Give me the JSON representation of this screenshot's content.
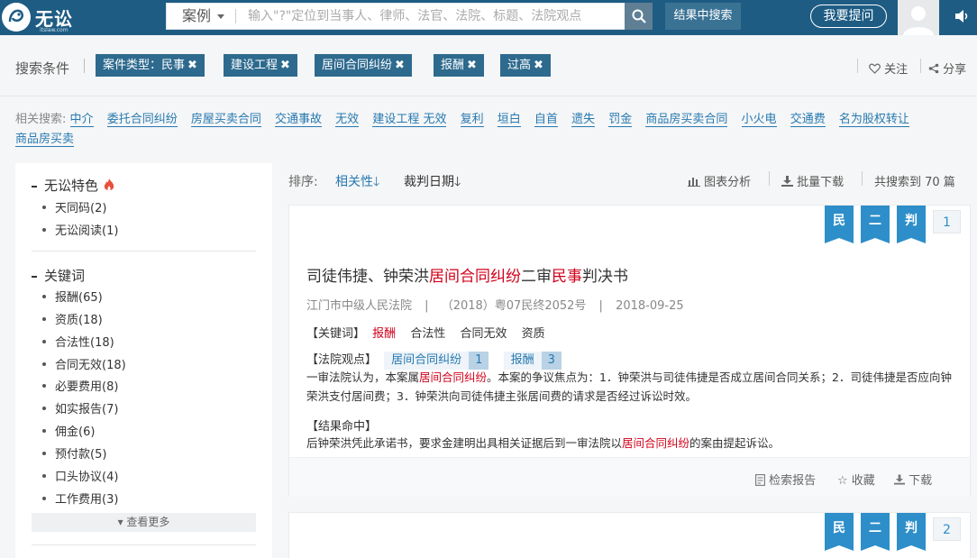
{
  "header": {
    "logo_text": "无讼",
    "logo_sub": "itslaw.com",
    "search_type": "案例",
    "search_placeholder": "输入\"?\"定位到当事人、律师、法官、法院、标题、法院观点",
    "within_label": "结果中搜索",
    "ask_label": "我要提问"
  },
  "filters": {
    "label": "搜索条件",
    "chips": [
      "案件类型：民事",
      "建设工程",
      "居间合同纠纷",
      "报酬",
      "过高"
    ],
    "follow": "关注",
    "share": "分享"
  },
  "related": {
    "label": "相关搜索:",
    "items": [
      "中介",
      "委托合同纠纷",
      "房屋买卖合同",
      "交通事故",
      "无效",
      "建设工程 无效",
      "复利",
      "垣白",
      "自首",
      "遗失",
      "罚金",
      "商品房买卖合同",
      "小火电",
      "交通费",
      "名为股权转让",
      "商品房买卖"
    ]
  },
  "sidebar": {
    "sec1_title": "无讼特色",
    "sec1_items": [
      "天同码(2)",
      "无讼阅读(1)"
    ],
    "sec2_title": "关键词",
    "sec2_items": [
      "报酬(65)",
      "资质(18)",
      "合法性(18)",
      "合同无效(18)",
      "必要费用(8)",
      "如实报告(7)",
      "佣金(6)",
      "预付款(5)",
      "口头协议(4)",
      "工作费用(3)"
    ],
    "more": "▾ 查看更多"
  },
  "sort": {
    "label": "排序:",
    "relevance": "相关性",
    "date": "裁判日期",
    "chart": "图表分析",
    "batch": "批量下载",
    "total": "共搜索到 70 篇"
  },
  "badges": [
    "民",
    "二",
    "判"
  ],
  "cards": [
    {
      "num": "1",
      "title_pre": "司徒伟捷、钟荣洪",
      "title_hl1": "居间合同纠纷",
      "title_mid": "二审",
      "title_hl2": "民事",
      "title_post": "判决书",
      "court": "江门市中级人民法院",
      "sep": "|",
      "case_no": "（2018）粤07民终2052号",
      "date": "2018-09-25",
      "kw_label": "【关键词】",
      "kw_hl": "报酬",
      "kw_items": [
        "合法性",
        "合同无效",
        "资质"
      ],
      "op_label": "【法院观点】",
      "op_tag1": "居间合同纠纷",
      "op_num1": "1",
      "op_tag2": "报酬",
      "op_num2": "3",
      "op_pre": "一审法院认为，本案属",
      "op_hl": "居间合同纠纷",
      "op_post": "。本案的争议焦点为：1．钟荣洪与司徒伟捷是否成立居间合同关系；2．司徒伟捷是否应向钟荣洪支付居间费；3．钟荣洪向司徒伟捷主张居间费的请求是否经过诉讼时效。",
      "res_label": "【结果命中】",
      "res_pre": "后钟荣洪凭此承诺书，要求金建明出具相关证据后到一审法院以",
      "res_hl": "居间合同纠纷",
      "res_post": "的案由提起诉讼。",
      "report": "检索报告",
      "fav": "收藏",
      "download": "下载"
    },
    {
      "num": "2"
    }
  ]
}
